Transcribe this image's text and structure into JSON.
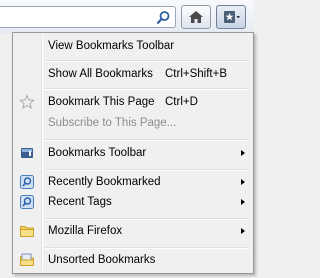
{
  "toolbar": {
    "search_icon": "magnifier-icon",
    "home_icon": "home-icon",
    "bookmarks_icon": "bookmarks-star-icon"
  },
  "menu": {
    "items": [
      {
        "label": "View Bookmarks Toolbar",
        "accel": "",
        "icon": "",
        "submenu": false,
        "enabled": true
      },
      {
        "label": "Show All Bookmarks",
        "accel": "Ctrl+Shift+B",
        "icon": "",
        "submenu": false,
        "enabled": true
      },
      {
        "label": "Bookmark This Page",
        "accel": "Ctrl+D",
        "icon": "star-outline-icon",
        "submenu": false,
        "enabled": true
      },
      {
        "label": "Subscribe to This Page...",
        "accel": "",
        "icon": "",
        "submenu": false,
        "enabled": false
      },
      {
        "label": "Bookmarks Toolbar",
        "accel": "",
        "icon": "bookmarks-toolbar-icon",
        "submenu": true,
        "enabled": true
      },
      {
        "label": "Recently Bookmarked",
        "accel": "",
        "icon": "smart-folder-icon",
        "submenu": true,
        "enabled": true
      },
      {
        "label": "Recent Tags",
        "accel": "",
        "icon": "smart-folder-icon",
        "submenu": true,
        "enabled": true
      },
      {
        "label": "Mozilla Firefox",
        "accel": "",
        "icon": "folder-icon",
        "submenu": true,
        "enabled": true
      },
      {
        "label": "Unsorted Bookmarks",
        "accel": "",
        "icon": "unsorted-bookmarks-icon",
        "submenu": false,
        "enabled": true
      }
    ]
  }
}
